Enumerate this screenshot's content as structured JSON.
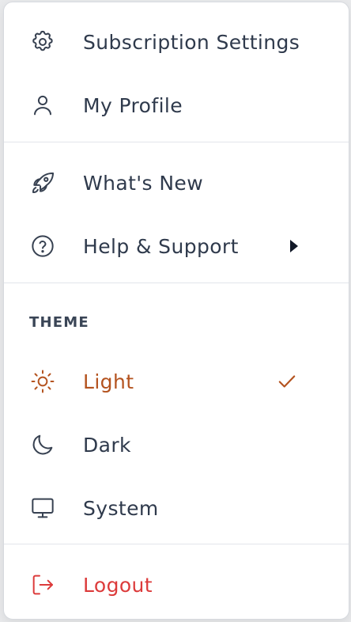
{
  "menu": {
    "account": [
      {
        "label": "Subscription Settings",
        "icon": "gear-icon"
      },
      {
        "label": "My Profile",
        "icon": "user-icon"
      }
    ],
    "resources": [
      {
        "label": "What's New",
        "icon": "rocket-icon"
      },
      {
        "label": "Help & Support",
        "icon": "question-circle-icon",
        "has_submenu": true
      }
    ],
    "theme": {
      "heading": "THEME",
      "options": [
        {
          "label": "Light",
          "icon": "sun-icon",
          "selected": true
        },
        {
          "label": "Dark",
          "icon": "moon-icon",
          "selected": false
        },
        {
          "label": "System",
          "icon": "monitor-icon",
          "selected": false
        }
      ]
    },
    "logout": {
      "label": "Logout",
      "icon": "logout-icon"
    }
  },
  "colors": {
    "text": "#2f3a4c",
    "accent_selected": "#b4531f",
    "danger": "#dc3b3b",
    "divider": "#e2e5ea"
  }
}
